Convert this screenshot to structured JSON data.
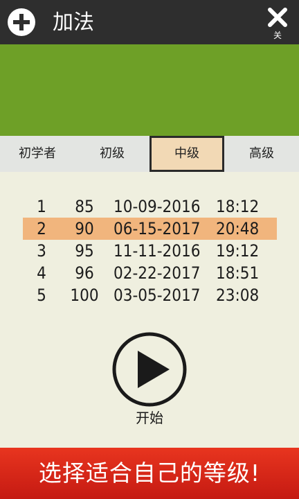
{
  "header": {
    "title": "加法",
    "close_label": "关"
  },
  "tabs": [
    {
      "label": "初学者",
      "selected": false
    },
    {
      "label": "初级",
      "selected": false
    },
    {
      "label": "中级",
      "selected": true
    },
    {
      "label": "高级",
      "selected": false
    }
  ],
  "scores": [
    {
      "rank": "1",
      "score": "85",
      "date": "10-09-2016",
      "time": "18:12",
      "highlighted": false
    },
    {
      "rank": "2",
      "score": "90",
      "date": "06-15-2017",
      "time": "20:48",
      "highlighted": true
    },
    {
      "rank": "3",
      "score": "95",
      "date": "11-11-2016",
      "time": "19:12",
      "highlighted": false
    },
    {
      "rank": "4",
      "score": "96",
      "date": "02-22-2017",
      "time": "18:51",
      "highlighted": false
    },
    {
      "rank": "5",
      "score": "100",
      "date": "03-05-2017",
      "time": "23:08",
      "highlighted": false
    }
  ],
  "play": {
    "label": "开始"
  },
  "promo": {
    "text": "选择适合自己的等级!"
  },
  "colors": {
    "header_bg": "#2e2e2e",
    "banner_green": "#6ea027",
    "tab_selected_bg": "#f2d9b5",
    "row_highlight": "#f1b57d",
    "promo_red": "#d9261a",
    "page_bg": "#efefdf"
  },
  "icons": {
    "add": "plus-circle-icon",
    "close": "close-x-icon",
    "play": "play-circle-icon"
  }
}
